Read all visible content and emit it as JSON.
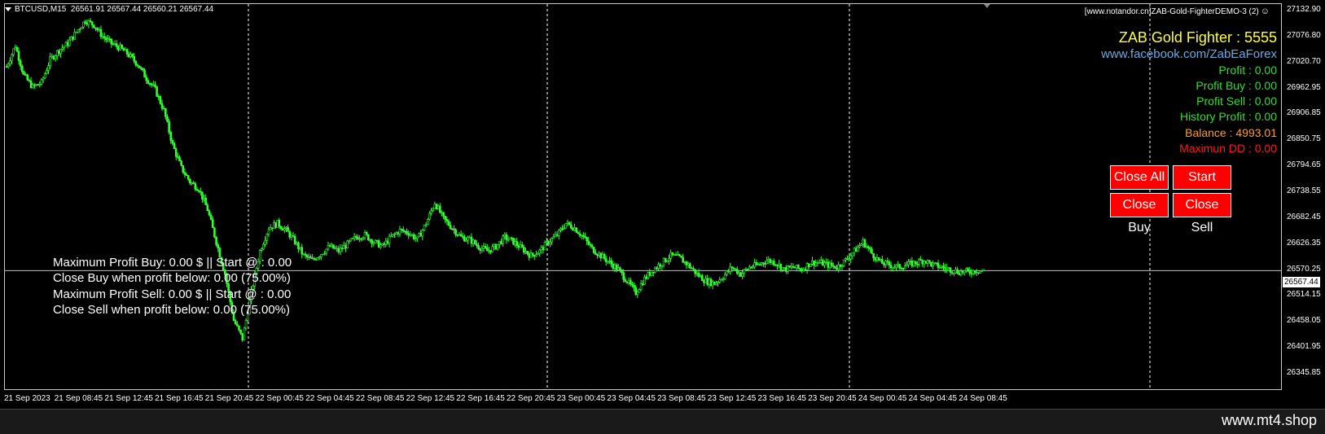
{
  "chart": {
    "symbol": "BTCUSD,M15",
    "ohlc": "26561.91 26567.44 26560.21 26567.44",
    "broker_label": "[www.notandor.cn]ZAB-Gold-FighterDEMO-3 (2)",
    "smiley_icon": "smiley-face-icon",
    "current_price_label": "26567.44",
    "current_price": 26567.44,
    "y_ticks": [
      "27132.90",
      "27076.80",
      "27020.70",
      "26962.95",
      "26906.85",
      "26850.75",
      "26794.65",
      "26738.55",
      "26682.45",
      "26626.35",
      "26570.25",
      "26514.15",
      "26458.05",
      "26401.95",
      "26345.85"
    ],
    "x_ticks": [
      "21 Sep 2023",
      "21 Sep 08:45",
      "21 Sep 12:45",
      "21 Sep 16:45",
      "21 Sep 20:45",
      "22 Sep 00:45",
      "22 Sep 04:45",
      "22 Sep 08:45",
      "22 Sep 12:45",
      "22 Sep 16:45",
      "22 Sep 20:45",
      "23 Sep 00:45",
      "23 Sep 04:45",
      "23 Sep 08:45",
      "23 Sep 12:45",
      "23 Sep 16:45",
      "23 Sep 20:45",
      "24 Sep 00:45",
      "24 Sep 04:45",
      "24 Sep 08:45"
    ],
    "colors": {
      "candle": "#33ff33",
      "background": "#000000",
      "grid": "#ffffff",
      "price_line": "#c0c0c0"
    }
  },
  "chart_data": {
    "type": "line",
    "title": "BTCUSD,M15",
    "ylim": [
      26345.85,
      27132.9
    ],
    "grid": true,
    "x_start": "21 Sep 2023",
    "x_end": "24 Sep 08:45",
    "series": [
      {
        "values": [
          27010,
          27055,
          26990,
          26965,
          26975,
          27025,
          27045,
          27060,
          27085,
          27110,
          27100,
          27075,
          27060,
          27050,
          27035,
          27015,
          26985,
          26960,
          26915,
          26840,
          26790,
          26760,
          26745,
          26700,
          26630,
          26560,
          26460,
          26420,
          26520,
          26610,
          26660,
          26670,
          26655,
          26630,
          26600,
          26590,
          26605,
          26620,
          26610,
          26625,
          26640,
          26645,
          26630,
          26620,
          26640,
          26655,
          26650,
          26635,
          26670,
          26715,
          26680,
          26660,
          26640,
          26635,
          26620,
          26610,
          26620,
          26640,
          26630,
          26615,
          26600,
          26610,
          26630,
          26645,
          26670,
          26660,
          26640,
          26615,
          26600,
          26585,
          26570,
          26545,
          26520,
          26550,
          26570,
          26585,
          26600,
          26595,
          26580,
          26560,
          26545,
          26540,
          26555,
          26575,
          26560,
          26575,
          26580,
          26590,
          26585,
          26570,
          26575,
          26570,
          26585,
          26585,
          26580,
          26575,
          26590,
          26610,
          26630,
          26605,
          26585,
          26580,
          26575,
          26580,
          26585,
          26590,
          26580,
          26575,
          26570,
          26565,
          26565,
          26568,
          26567
        ]
      }
    ]
  },
  "ea_panel": {
    "title": "ZAB Gold Fighter : 5555",
    "link": "www.facebook.com/ZabEaForex",
    "profit": "Profit : 0.00",
    "profit_buy": "Profit Buy : 0.00",
    "profit_sell": "Profit Sell : 0.00",
    "history_profit": "History Profit : 0.00",
    "balance": "Balance : 4993.01",
    "max_dd": "Maximun DD : 0.00",
    "colors": {
      "title": "#ffff33",
      "link": "#6fa8dc",
      "profit": "#33dd33",
      "balance": "#ff9933",
      "dd": "#ff1a1a",
      "button": "#ff0000"
    }
  },
  "buttons": {
    "close_all": "Close All",
    "start": "Start",
    "close_buy": "Close Buy",
    "close_sell": "Close Sell"
  },
  "stats": {
    "max_profit_buy": "Maximum Profit Buy: 0.00 $ || Start @ : 0.00",
    "close_buy_below": "Close Buy when profit below: 0.00 (75.00%)",
    "max_profit_sell": "Maximum Profit Sell: 0.00 $ || Start @ : 0.00",
    "close_sell_below": "Close Sell when profit below: 0.00 (75.00%)"
  },
  "footer": {
    "watermark": "www.mt4.shop"
  }
}
